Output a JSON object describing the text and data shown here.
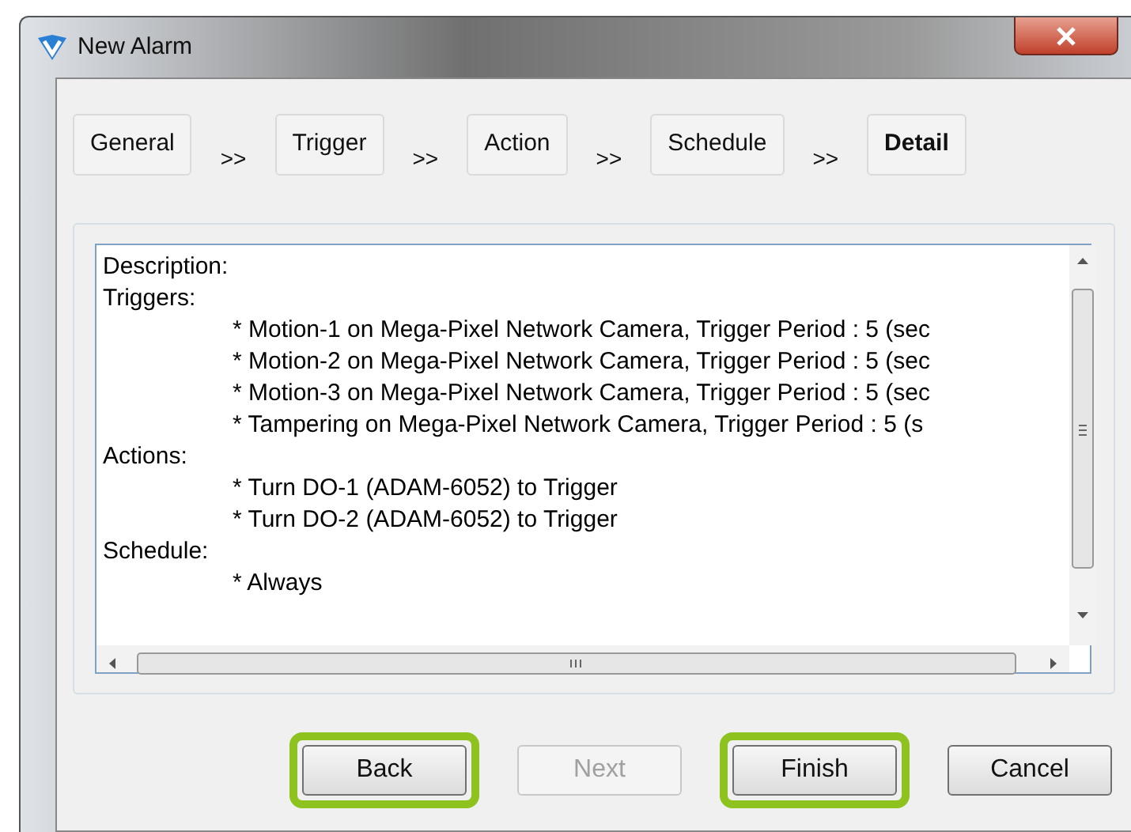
{
  "window": {
    "title": "New Alarm"
  },
  "steps": [
    {
      "label": "General",
      "selected": false,
      "separator": ">>"
    },
    {
      "label": "Trigger",
      "selected": false,
      "separator": ">>"
    },
    {
      "label": "Action",
      "selected": false,
      "separator": ">>"
    },
    {
      "label": "Schedule",
      "selected": false,
      "separator": ">>"
    },
    {
      "label": "Detail",
      "selected": true
    }
  ],
  "detail_lines": [
    {
      "kind": "heading",
      "text": "Description:"
    },
    {
      "kind": "heading",
      "text": "Triggers:"
    },
    {
      "kind": "item",
      "text": "* Motion-1 on Mega-Pixel Network Camera, Trigger Period : 5 (sec"
    },
    {
      "kind": "item",
      "text": "* Motion-2 on Mega-Pixel Network Camera, Trigger Period : 5 (sec"
    },
    {
      "kind": "item",
      "text": "* Motion-3 on Mega-Pixel Network Camera, Trigger Period : 5 (sec"
    },
    {
      "kind": "item",
      "text": "* Tampering on Mega-Pixel Network Camera, Trigger Period : 5 (s"
    },
    {
      "kind": "heading",
      "text": "Actions:"
    },
    {
      "kind": "item",
      "text": "* Turn DO-1 (ADAM-6052) to Trigger"
    },
    {
      "kind": "item",
      "text": "* Turn DO-2 (ADAM-6052) to Trigger"
    },
    {
      "kind": "heading",
      "text": "Schedule:"
    },
    {
      "kind": "item",
      "text": "* Always"
    }
  ],
  "buttons": [
    {
      "label": "Back",
      "disabled": false,
      "highlighted": true
    },
    {
      "label": "Next",
      "disabled": true,
      "highlighted": false
    },
    {
      "label": "Finish",
      "disabled": false,
      "highlighted": true
    },
    {
      "label": "Cancel",
      "disabled": false,
      "highlighted": false
    }
  ]
}
